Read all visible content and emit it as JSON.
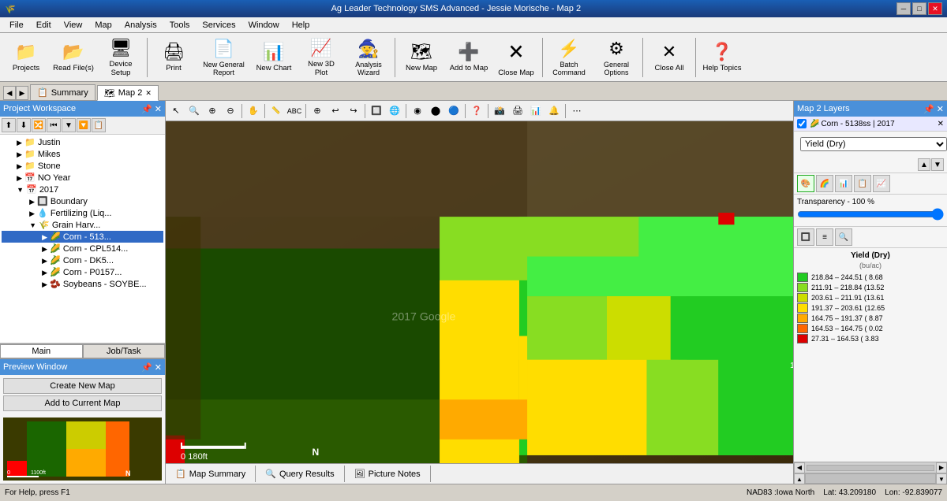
{
  "titlebar": {
    "title": "Ag Leader Technology SMS Advanced - Jessie Morische - Map 2",
    "min_label": "─",
    "max_label": "□",
    "close_label": "✕"
  },
  "menubar": {
    "items": [
      "File",
      "Edit",
      "View",
      "Map",
      "Analysis",
      "Tools",
      "Services",
      "Window",
      "Help"
    ]
  },
  "toolbar": {
    "buttons": [
      {
        "id": "projects",
        "icon": "📁",
        "label": "Projects"
      },
      {
        "id": "read-files",
        "icon": "📂",
        "label": "Read File(s)"
      },
      {
        "id": "device-setup",
        "icon": "🖥",
        "label": "Device Setup"
      },
      {
        "id": "print",
        "icon": "🖨",
        "label": "Print"
      },
      {
        "id": "new-general-report",
        "icon": "📄",
        "label": "New General\nReport"
      },
      {
        "id": "new-chart",
        "icon": "📊",
        "label": "New Chart"
      },
      {
        "id": "new-3d-plot",
        "icon": "📈",
        "label": "New 3D Plot"
      },
      {
        "id": "analysis-wizard",
        "icon": "🧙",
        "label": "Analysis\nWizard"
      },
      {
        "id": "new-map",
        "icon": "🗺",
        "label": "New Map"
      },
      {
        "id": "add-to-map",
        "icon": "➕",
        "label": "Add to Map"
      },
      {
        "id": "close-map",
        "icon": "✕",
        "label": "Close Map"
      },
      {
        "id": "batch-command",
        "icon": "⚡",
        "label": "Batch\nCommand"
      },
      {
        "id": "general-options",
        "icon": "⚙",
        "label": "General\nOptions"
      },
      {
        "id": "close-all",
        "icon": "✕",
        "label": "Close All"
      },
      {
        "id": "help-topics",
        "icon": "❓",
        "label": "Help Topics"
      }
    ]
  },
  "tabbar": {
    "tabs": [
      {
        "id": "summary",
        "label": "Summary",
        "icon": "📋",
        "active": false,
        "closable": false
      },
      {
        "id": "map2",
        "label": "Map 2",
        "icon": "🗺",
        "active": true,
        "closable": true
      }
    ]
  },
  "project_workspace": {
    "title": "Project Workspace",
    "tools": [
      "⬆",
      "⬇",
      "📁",
      "⏮",
      "🔽",
      "🔽",
      "📋"
    ],
    "tree": [
      {
        "id": "justin",
        "label": "Justin",
        "level": 0,
        "expand": false,
        "icon": ""
      },
      {
        "id": "mikes",
        "label": "Mikes",
        "level": 0,
        "expand": false,
        "icon": ""
      },
      {
        "id": "stone",
        "label": "Stone",
        "level": 0,
        "expand": false,
        "icon": ""
      },
      {
        "id": "no-year",
        "label": "NO Year",
        "level": 1,
        "expand": false,
        "icon": "📅"
      },
      {
        "id": "2017",
        "label": "2017",
        "level": 1,
        "expand": true,
        "icon": "📅"
      },
      {
        "id": "boundary",
        "label": "Boundary",
        "level": 2,
        "expand": false,
        "icon": "🔲"
      },
      {
        "id": "fertilizing",
        "label": "Fertilizing (Liq...",
        "level": 2,
        "expand": false,
        "icon": "💧"
      },
      {
        "id": "grain-harv",
        "label": "Grain Harv...",
        "level": 2,
        "expand": true,
        "icon": "🌾"
      },
      {
        "id": "corn-513",
        "label": "Corn - 513...",
        "level": 3,
        "expand": false,
        "icon": "🌽",
        "selected": true
      },
      {
        "id": "corn-cpl",
        "label": "Corn - CPL514...",
        "level": 3,
        "expand": false,
        "icon": "🌽"
      },
      {
        "id": "corn-dk5",
        "label": "Corn - DK5...",
        "level": 3,
        "expand": false,
        "icon": "🌽"
      },
      {
        "id": "corn-p0157",
        "label": "Corn - P0157...",
        "level": 3,
        "expand": false,
        "icon": "🌽"
      },
      {
        "id": "soybeans",
        "label": "Soybeans - SOYBE...",
        "level": 3,
        "expand": false,
        "icon": "🫘"
      }
    ],
    "tabs": [
      {
        "id": "main",
        "label": "Main",
        "active": true
      },
      {
        "id": "job-task",
        "label": "Job/Task",
        "active": false
      }
    ]
  },
  "preview_window": {
    "title": "Preview Window",
    "create_btn": "Create New Map",
    "add_btn": "Add to Current Map",
    "scale_left": "0",
    "scale_right": "1100ft",
    "north": "N"
  },
  "map_toolbar": {
    "tools": [
      "↖",
      "🔍",
      "🔍+",
      "🔍-",
      "✋",
      "📏",
      "ABC",
      "⊕",
      "↩",
      "↪",
      "🔲",
      "🌐",
      "◉",
      "🔴",
      "🔵",
      "❓",
      "📸",
      "🖨",
      "📊",
      "🔔",
      "⋯"
    ]
  },
  "map_content": {
    "watermark": "2017 Google"
  },
  "map_bottom": {
    "tabs": [
      {
        "id": "map-summary",
        "label": "Map Summary",
        "icon": "📋",
        "active": false
      },
      {
        "id": "query-results",
        "label": "Query Results",
        "icon": "🔍",
        "active": false
      },
      {
        "id": "picture-notes",
        "label": "Picture Notes",
        "icon": "🖼",
        "active": false
      }
    ]
  },
  "layers_panel": {
    "title": "Map 2 Layers",
    "layer_name": "Corn - 5138ss | 2017",
    "layer_checked": true,
    "dropdown_value": "Yield (Dry)",
    "transparency_label": "Transparency - 100 %",
    "legend": {
      "title": "Yield (Dry)",
      "unit": "(bu/ac)",
      "rows": [
        {
          "color": "#22cc22",
          "text": "218.84 – 244.51  ( 8.68"
        },
        {
          "color": "#88dd22",
          "text": "211.91 – 218.84 (13.52"
        },
        {
          "color": "#ccdd00",
          "text": "203.61 – 211.91 (13.61"
        },
        {
          "color": "#ffdd00",
          "text": "191.37 – 203.61 (12.65"
        },
        {
          "color": "#ffaa00",
          "text": "164.75 – 191.37  ( 8.87"
        },
        {
          "color": "#ff6600",
          "text": "164.53 – 164.75  ( 0.02"
        },
        {
          "color": "#dd0000",
          "text": "  27.31 – 164.53  ( 3.83"
        }
      ]
    }
  },
  "statusbar": {
    "help_text": "For Help, press F1",
    "coord_system": "NAD83 :Iowa North",
    "lat": "Lat: 43.209180",
    "lon": "Lon: -92.839077"
  }
}
